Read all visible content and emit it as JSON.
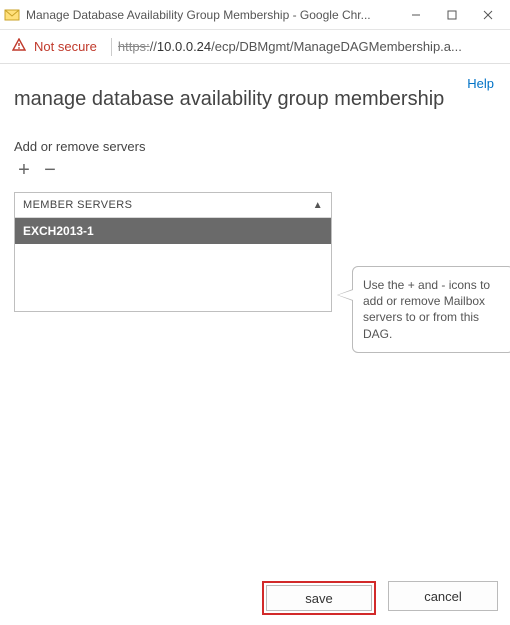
{
  "window": {
    "title": "Manage Database Availability Group Membership - Google Chr..."
  },
  "address": {
    "not_secure": "Not secure",
    "scheme": "https",
    "host": "10.0.0.24",
    "path": "/ecp/DBMgmt/ManageDAGMembership.a..."
  },
  "help": {
    "label": "Help"
  },
  "page": {
    "title": "manage database availability group membership",
    "section_label": "Add or remove servers"
  },
  "toolbar": {
    "add_glyph": "+",
    "remove_glyph": "−"
  },
  "grid": {
    "header": "MEMBER SERVERS",
    "sort_glyph": "▲",
    "rows": [
      "EXCH2013-1"
    ]
  },
  "hint": {
    "text": "Use the + and - icons to add or remove Mailbox servers to or from this DAG."
  },
  "footer": {
    "save_label": "save",
    "cancel_label": "cancel"
  }
}
